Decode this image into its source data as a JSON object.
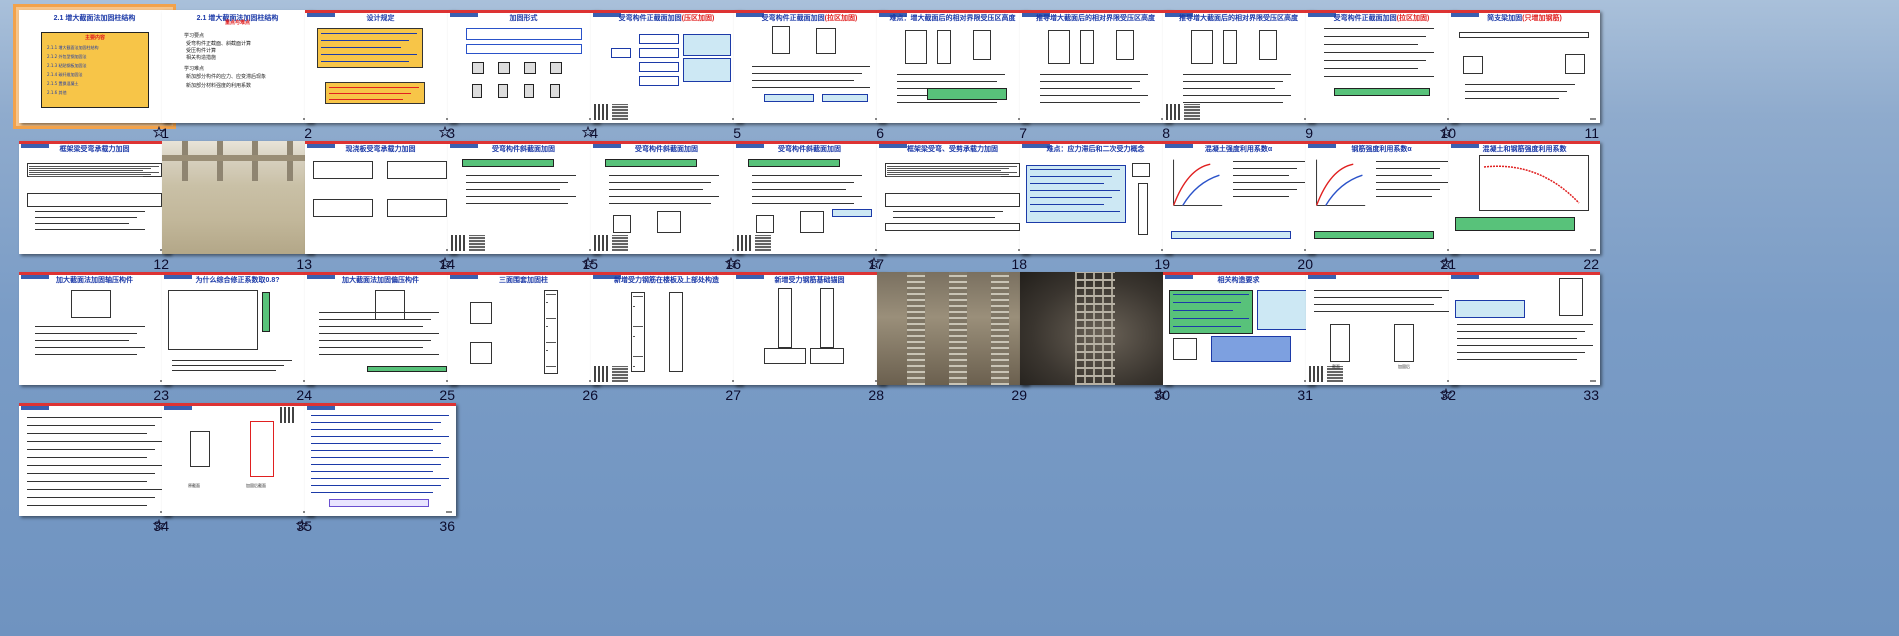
{
  "slides": [
    {
      "num": "1",
      "title": "2.1 增大截面法加固柱结构",
      "selected": true
    },
    {
      "num": "2",
      "title": "2.1 增大截面法加固柱结构",
      "subtitle": "重点与难点"
    },
    {
      "num": "3",
      "title": "设计规定"
    },
    {
      "num": "4",
      "title": "加固形式"
    },
    {
      "num": "5",
      "title": "受弯构件正截面加固",
      "title_red": "(压区加固)"
    },
    {
      "num": "6",
      "title": "受弯构件正截面加固",
      "title_red": "(拉区加固)"
    },
    {
      "num": "7",
      "title": "难点：增大截面后的相对界限受压区高度"
    },
    {
      "num": "8",
      "title": "推导增大截面后的相对界限受压区高度"
    },
    {
      "num": "9",
      "title": "推导增大截面后的相对界限受压区高度"
    },
    {
      "num": "10",
      "title": "受弯构件正截面加固",
      "title_red": "(拉区加固)"
    },
    {
      "num": "11",
      "title": "简支梁加固",
      "title_red": "(只增加钢筋)"
    },
    {
      "num": "12",
      "title": "框架梁受弯承载力加固"
    },
    {
      "num": "13",
      "title": ""
    },
    {
      "num": "14",
      "title": "现浇板受弯承载力加固"
    },
    {
      "num": "15",
      "title": "受弯构件斜截面加固"
    },
    {
      "num": "16",
      "title": "受弯构件斜截面加固"
    },
    {
      "num": "17",
      "title": "受弯构件斜截面加固"
    },
    {
      "num": "18",
      "title": "框架梁受弯、受剪承载力加固"
    },
    {
      "num": "19",
      "title": "难点：应力滞后和二次受力概念"
    },
    {
      "num": "20",
      "title": "混凝土强度利用系数α"
    },
    {
      "num": "21",
      "title": "钢筋强度利用系数α"
    },
    {
      "num": "22",
      "title": "混凝土和钢筋强度利用系数"
    },
    {
      "num": "23",
      "title": "加大截面法加固轴压构件"
    },
    {
      "num": "24",
      "title": "为什么综合修正系数取0.8?"
    },
    {
      "num": "25",
      "title": "加大截面法加固偏压构件"
    },
    {
      "num": "26",
      "title": "三面围套加固柱"
    },
    {
      "num": "27",
      "title": "新增受力钢筋在楼板及上部处构造"
    },
    {
      "num": "28",
      "title": "新增受力钢筋基础锚固"
    },
    {
      "num": "29",
      "title": ""
    },
    {
      "num": "30",
      "title": ""
    },
    {
      "num": "31",
      "title": "相关构造要求"
    },
    {
      "num": "32",
      "title": ""
    },
    {
      "num": "33",
      "title": ""
    },
    {
      "num": "34",
      "title": ""
    },
    {
      "num": "35",
      "title": ""
    },
    {
      "num": "36",
      "title": ""
    }
  ],
  "slide1": {
    "menu_title": "主要内容",
    "items": [
      "2.1.1 增大截面法加固柱结构",
      "2.1.2 外包型钢加固法",
      "2.1.3 粘贴钢板加固法",
      "2.1.4 碳纤维加固法",
      "2.1.5 置换混凝土",
      "2.1.6 其他"
    ]
  },
  "slide2": {
    "heading_a": "学习要点",
    "items_a": [
      "受弯构件正截面、斜截面计算",
      "受压构件计算",
      "相关构造措施"
    ],
    "heading_b": "学习难点",
    "items_b": [
      "新加部分构件的应力、应变滞后现象",
      "新加部分材料强度的利用系数"
    ]
  },
  "slide32": {
    "label_a": "截面",
    "label_b": "加固后"
  },
  "slide35": {
    "label_a": "原截面",
    "label_b": "加固后截面"
  },
  "colors": {
    "accent": "#1c3aa8",
    "red": "#e02020",
    "selected_border": "#f2a24b",
    "yellow": "#f7c548"
  }
}
